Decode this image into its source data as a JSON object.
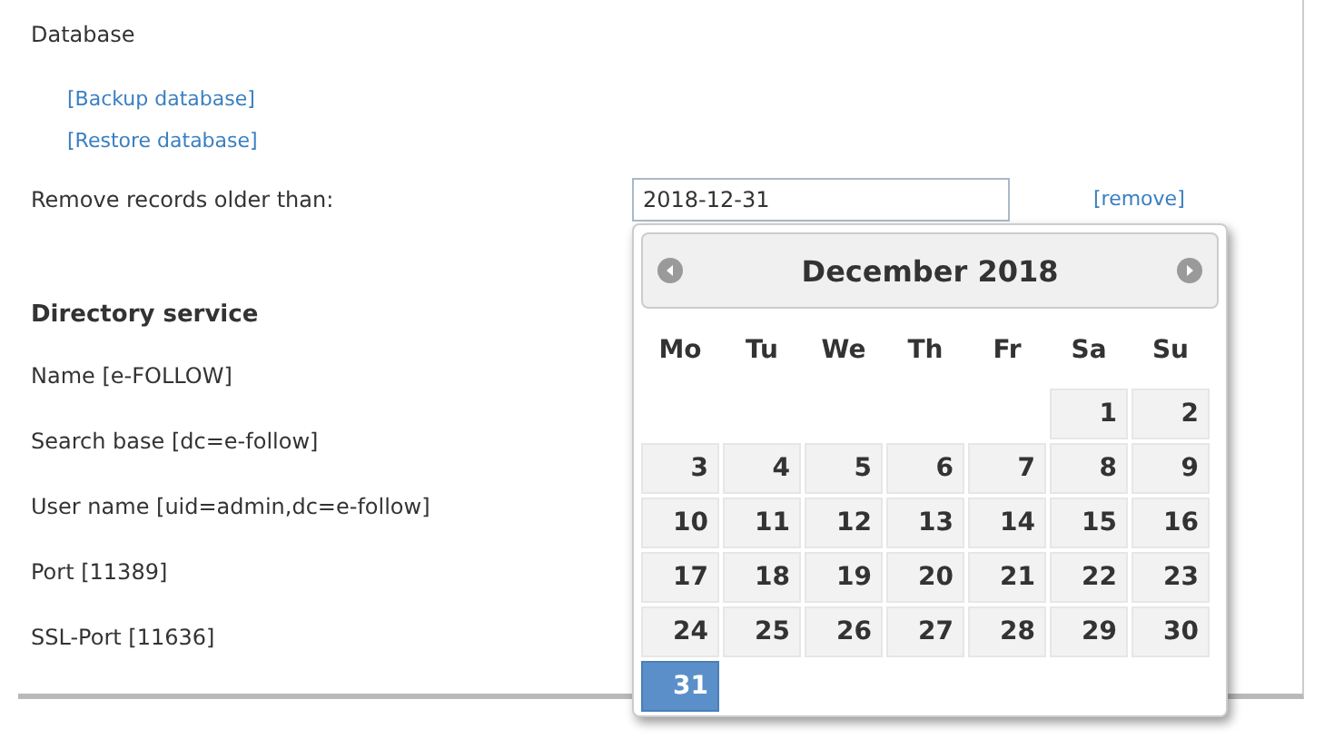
{
  "database": {
    "title": "Database",
    "links": [
      "[Backup database]",
      "[Restore database]"
    ],
    "remove_label": "Remove records older than:",
    "date_value": "2018-12-31",
    "remove_link": "[remove]"
  },
  "directory": {
    "title": "Directory service",
    "items": [
      "Name [e-FOLLOW]",
      "Search base [dc=e-follow]",
      "User name [uid=admin,dc=e-follow]",
      "Port [11389]",
      "SSL-Port [11636]"
    ]
  },
  "calendar": {
    "title": "December 2018",
    "weekdays": [
      "Mo",
      "Tu",
      "We",
      "Th",
      "Fr",
      "Sa",
      "Su"
    ],
    "weeks": [
      [
        {
          "day": "1",
          "selected": false
        },
        {
          "day": "2",
          "selected": false
        }
      ],
      [
        {
          "day": "3",
          "selected": false
        },
        {
          "day": "4",
          "selected": false
        },
        {
          "day": "5",
          "selected": false
        },
        {
          "day": "6",
          "selected": false
        },
        {
          "day": "7",
          "selected": false
        },
        {
          "day": "8",
          "selected": false
        },
        {
          "day": "9",
          "selected": false
        }
      ],
      [
        {
          "day": "10",
          "selected": false
        },
        {
          "day": "11",
          "selected": false
        },
        {
          "day": "12",
          "selected": false
        },
        {
          "day": "13",
          "selected": false
        },
        {
          "day": "14",
          "selected": false
        },
        {
          "day": "15",
          "selected": false
        },
        {
          "day": "16",
          "selected": false
        }
      ],
      [
        {
          "day": "17",
          "selected": false
        },
        {
          "day": "18",
          "selected": false
        },
        {
          "day": "19",
          "selected": false
        },
        {
          "day": "20",
          "selected": false
        },
        {
          "day": "21",
          "selected": false
        },
        {
          "day": "22",
          "selected": false
        },
        {
          "day": "23",
          "selected": false
        }
      ],
      [
        {
          "day": "24",
          "selected": false
        },
        {
          "day": "25",
          "selected": false
        },
        {
          "day": "26",
          "selected": false
        },
        {
          "day": "27",
          "selected": false
        },
        {
          "day": "28",
          "selected": false
        },
        {
          "day": "29",
          "selected": false
        },
        {
          "day": "30",
          "selected": false
        }
      ],
      [
        {
          "day": "31",
          "selected": true
        }
      ]
    ]
  }
}
